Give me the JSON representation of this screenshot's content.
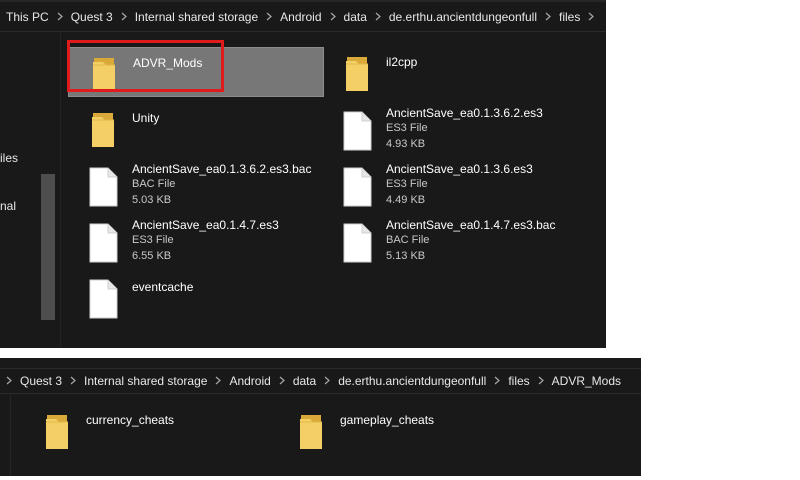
{
  "window_top": {
    "breadcrumb": [
      "This PC",
      "Quest 3",
      "Internal shared storage",
      "Android",
      "data",
      "de.erthu.ancientdungeonfull",
      "files"
    ],
    "nav_fragments": [
      "iles",
      "nal"
    ],
    "items": [
      {
        "name": "ADVR_Mods",
        "kind": "folder"
      },
      {
        "name": "il2cpp",
        "kind": "folder"
      },
      {
        "name": "Unity",
        "kind": "folder"
      },
      {
        "name": "AncientSave_ea0.1.3.6.2.es3",
        "type": "ES3 File",
        "size": "4.93 KB",
        "kind": "file"
      },
      {
        "name": "AncientSave_ea0.1.3.6.2.es3.bac",
        "type": "BAC File",
        "size": "5.03 KB",
        "kind": "file"
      },
      {
        "name": "AncientSave_ea0.1.3.6.es3",
        "type": "ES3 File",
        "size": "4.49 KB",
        "kind": "file"
      },
      {
        "name": "AncientSave_ea0.1.4.7.es3",
        "type": "ES3 File",
        "size": "6.55 KB",
        "kind": "file"
      },
      {
        "name": "AncientSave_ea0.1.4.7.es3.bac",
        "type": "BAC File",
        "size": "5.13 KB",
        "kind": "file"
      },
      {
        "name": "eventcache",
        "kind": "file"
      }
    ]
  },
  "window_bottom": {
    "breadcrumb": [
      "Quest 3",
      "Internal shared storage",
      "Android",
      "data",
      "de.erthu.ancientdungeonfull",
      "files",
      "ADVR_Mods"
    ],
    "items": [
      {
        "name": "currency_cheats",
        "kind": "folder"
      },
      {
        "name": "gameplay_cheats",
        "kind": "folder"
      }
    ]
  },
  "colors": {
    "background": "#191919",
    "selection": "#777777",
    "highlight_box": "#e01b1b",
    "folder": "#f4cf66"
  },
  "icons": {
    "folder": "folder-icon",
    "file": "file-icon",
    "separator": "chevron-right-icon"
  }
}
